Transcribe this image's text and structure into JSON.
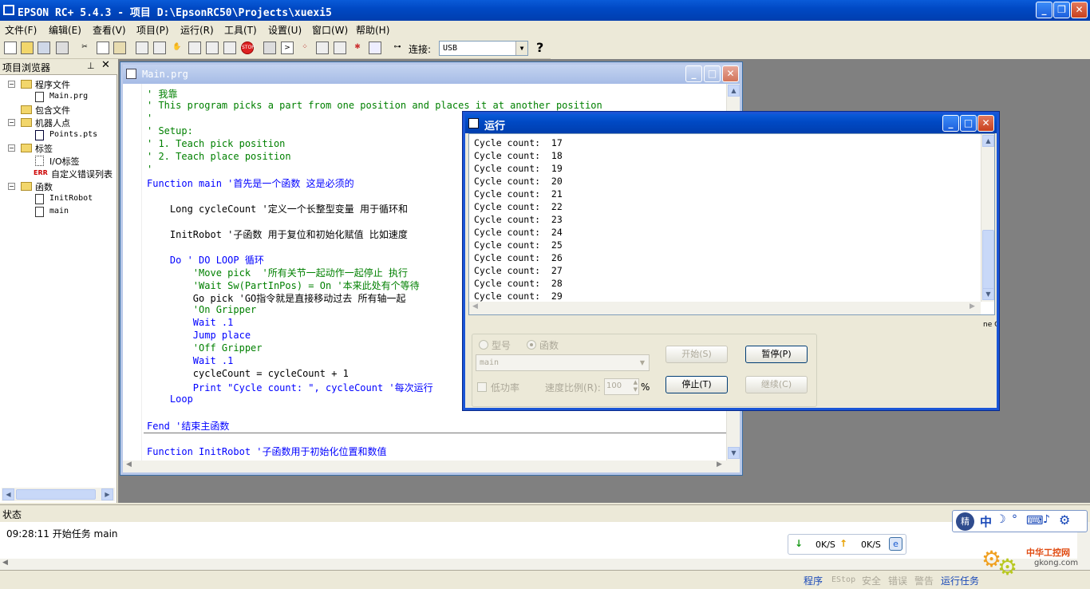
{
  "app": {
    "title": "EPSON RC+ 5.4.3 - 项目 D:\\EpsonRC50\\Projects\\xuexi5"
  },
  "menu": [
    "文件(F)",
    "编辑(E)",
    "查看(V)",
    "项目(P)",
    "运行(R)",
    "工具(T)",
    "设置(U)",
    "窗口(W)",
    "帮助(H)"
  ],
  "toolbar": {
    "connect_label": "连接:",
    "connection": "USB",
    "help": "?"
  },
  "project_browser": {
    "title": "项目浏览器",
    "items": [
      {
        "label": "程序文件"
      },
      {
        "label": "Main.prg"
      },
      {
        "label": "包含文件"
      },
      {
        "label": "机器人点"
      },
      {
        "label": "Points.pts"
      },
      {
        "label": "标签"
      },
      {
        "label": "I/O标签"
      },
      {
        "label": "自定义错误列表"
      },
      {
        "label": "函数"
      },
      {
        "label": "InitRobot"
      },
      {
        "label": "main"
      }
    ]
  },
  "editor": {
    "title": "Main.prg",
    "lines": [
      "' 我靠",
      "' This program picks a part from one position and places it at another position",
      "'",
      "' Setup:",
      "' 1. Teach pick position",
      "' 2. Teach place position",
      "'",
      "Function main '首先是一个函数 这是必须的",
      "",
      "    Long cycleCount '定义一个长整型变量 用于循环和",
      "",
      "    InitRobot '子函数 用于复位和初始化赋值 比如速度",
      "",
      "    Do ' DO LOOP 循环",
      "        'Move pick  '所有关节一起动作一起停止 执行",
      "        'Wait Sw(PartInPos) = On '本来此处有个等待",
      "        Go pick 'GO指令就是直接移动过去 所有轴一起",
      "        'On Gripper",
      "        Wait .1",
      "        Jump place",
      "        'Off Gripper",
      "        Wait .1",
      "        cycleCount = cycleCount + 1",
      "        Print \"Cycle count: \", cycleCount '每次运行",
      "    Loop",
      "",
      "Fend '结束主函数",
      "",
      "Function InitRobot '子函数用于初始化位置和数值"
    ]
  },
  "run_window": {
    "title": "运行",
    "output": [
      "Cycle count:  17",
      "Cycle count:  18",
      "Cycle count:  19",
      "Cycle count:  20",
      "Cycle count:  21",
      "Cycle count:  22",
      "Cycle count:  23",
      "Cycle count:  24",
      "Cycle count:  25",
      "Cycle count:  26",
      "Cycle count:  27",
      "Cycle count:  28",
      "Cycle count:  29"
    ],
    "radio_model": "型号",
    "radio_function": "函数",
    "function_select": "main",
    "low_power": "低功率",
    "speed_label": "速度比例(R):",
    "speed_value": "100",
    "percent": "%",
    "start": "开始(S)",
    "pause": "暂停(P)",
    "stop": "停止(T)",
    "continue": "继续(C)",
    "side_text": "ne C"
  },
  "status": {
    "title": "状态",
    "message": "09:28:11 开始任务 main"
  },
  "network": {
    "down": "0K/S",
    "up": "0K/S"
  },
  "ime": {
    "label": "中"
  },
  "statusbar": [
    "程序",
    "EStop",
    "安全",
    "错误",
    "警告",
    "运行任务"
  ],
  "watermark": {
    "cn": "中华工控网",
    "url": "gkong.com"
  }
}
